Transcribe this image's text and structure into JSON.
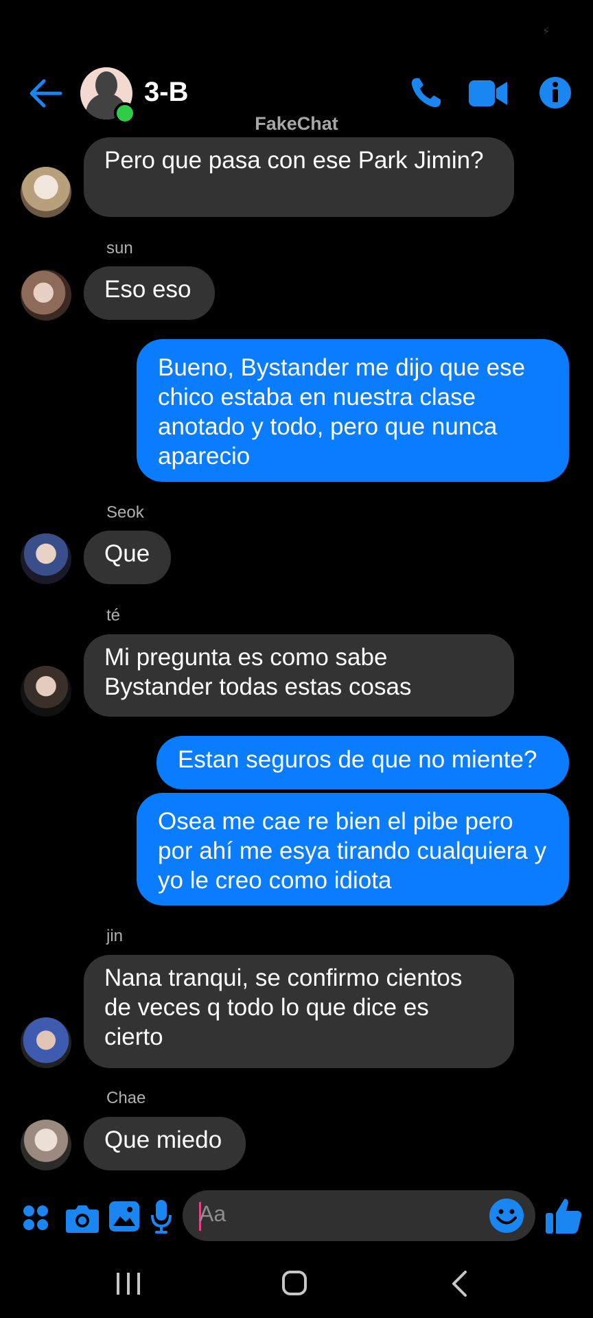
{
  "header": {
    "title": "3-B",
    "watermark": "FakeChat",
    "online": true,
    "icons": [
      "back-arrow-icon",
      "phone-icon",
      "video-camera-icon",
      "info-icon"
    ]
  },
  "messages": [
    {
      "type": "in",
      "sender": "",
      "text": "Pero que pasa con ese Park Jimin?"
    },
    {
      "type": "in",
      "sender": "sun",
      "text": "Eso eso"
    },
    {
      "type": "out",
      "text": "Bueno, Bystander me dijo que ese chico estaba en nuestra clase anotado y todo, pero que nunca aparecio"
    },
    {
      "type": "in",
      "sender": "Seok",
      "text": "Que"
    },
    {
      "type": "in",
      "sender": "té",
      "text": "Mi pregunta es como sabe Bystander todas estas cosas"
    },
    {
      "type": "out",
      "text": "Estan seguros de que no miente?"
    },
    {
      "type": "out",
      "text": "Osea me cae re bien el pibe pero por ahí me esya tirando cualquiera y yo le creo como idiota"
    },
    {
      "type": "in",
      "sender": "jin",
      "text": "Nana tranqui, se confirmo cientos de veces q todo lo que dice es cierto"
    },
    {
      "type": "in",
      "sender": "Chae",
      "text": "Que miedo"
    }
  ],
  "composer": {
    "placeholder": "Aa",
    "icons": [
      "apps-icon",
      "camera-icon",
      "image-icon",
      "microphone-icon",
      "emoji-icon",
      "thumbs-up-icon"
    ]
  },
  "colors": {
    "accent": "#0a7cff",
    "incoming_bubble": "#333333",
    "background": "#000000",
    "online": "#31cc46"
  }
}
